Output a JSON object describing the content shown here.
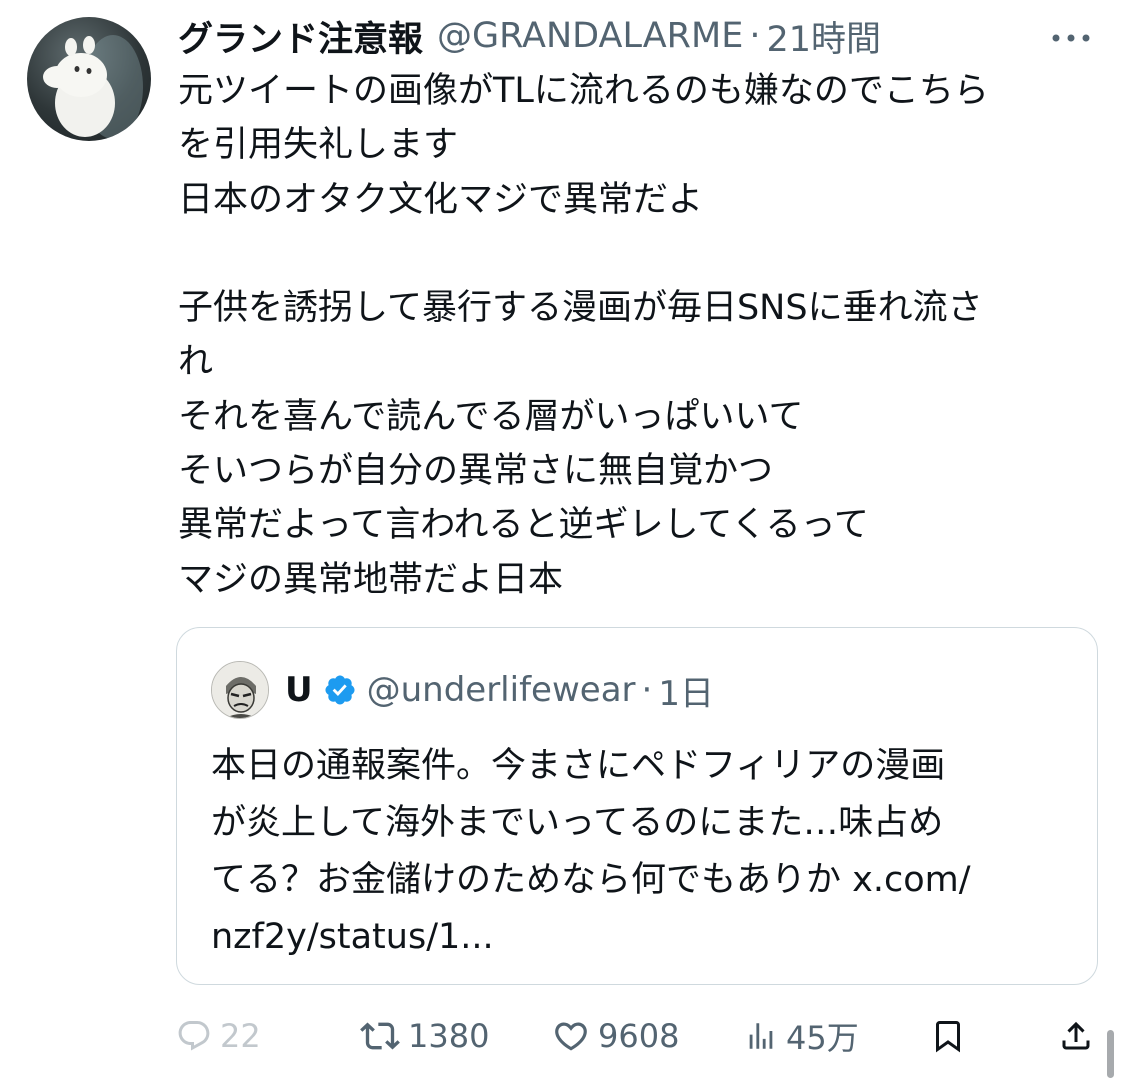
{
  "author": {
    "display_name": "グランド注意報",
    "handle": "@GRANDALARME",
    "separator": "·",
    "time": "21時間"
  },
  "tweet_text": "元ツイートの画像がTLに流れるのも嫌なのでこちら\nを引用失礼します\n日本のオタク文化マジで異常だよ\n\n子供を誘拐して暴行する漫画が毎日SNSに垂れ流さ\nれ\nそれを喜んで読んでる層がいっぱいいて\nそいつらが自分の異常さに無自覚かつ\n異常だよって言われると逆ギレしてくるって\nマジの異常地帯だよ日本",
  "quoted": {
    "display_name": "U",
    "handle": "@underlifewear",
    "separator": "·",
    "time": "1日",
    "verified_color": "#1d9bf0",
    "text": "本日の通報案件。今まさにペドフィリアの漫画\nが炎上して海外までいってるのにまた…味占め\nてる？お金儲けのためなら何でもありか x.com/\nnzf2y/status/1..."
  },
  "actions": {
    "replies": "22",
    "retweets": "1380",
    "likes": "9608",
    "views": "45万"
  },
  "icons": [
    "more-icon",
    "verified-icon",
    "reply-icon",
    "retweet-icon",
    "like-icon",
    "views-icon",
    "bookmark-icon",
    "share-icon"
  ]
}
